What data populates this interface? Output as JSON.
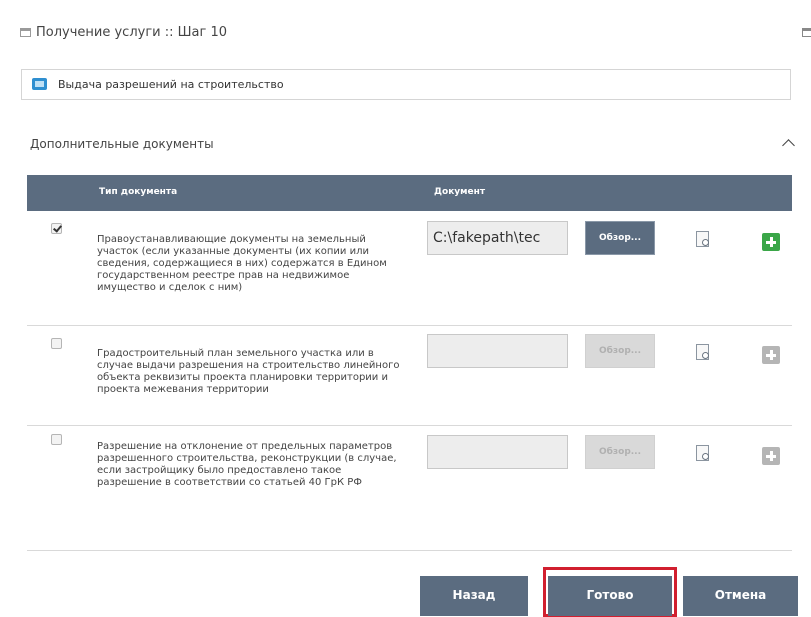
{
  "header": {
    "title": "Получение услуги :: Шаг 10"
  },
  "service": {
    "icon": "service-icon",
    "label": "Выдача разрешений на строительство"
  },
  "section": {
    "title": "Дополнительные документы"
  },
  "table": {
    "col_type": "Тип документа",
    "col_document": "Документ",
    "rows": [
      {
        "checked": true,
        "text": "Правоустанавливающие документы на земельный участок (если указанные документы (их копии или сведения, содержащиеся в них) содержатся в Едином государственном реестре прав на недвижимое имущество и сделок с ним)",
        "path": "C:\\fakepath\\tec",
        "browse": "Обзор...",
        "enabled": true
      },
      {
        "checked": false,
        "text": "Градостроительный план земельного участка или в случае выдачи разрешения на строительство линейного объекта реквизиты проекта планировки территории и проекта межевания территории",
        "path": "",
        "browse": "Обзор...",
        "enabled": false
      },
      {
        "checked": false,
        "text": "Разрешение на отклонение от предельных параметров разрешенного строительства, реконструкции (в случае, если застройщику было предоставлено такое разрешение в соответствии со статьей 40 ГрК РФ",
        "path": "",
        "browse": "Обзор...",
        "enabled": false
      }
    ]
  },
  "buttons": {
    "back": "Назад",
    "done": "Готово",
    "cancel": "Отмена"
  },
  "colors": {
    "header_bar": "#5b6c80",
    "add_green": "#3aa648",
    "highlight_red": "#d11f2f"
  }
}
